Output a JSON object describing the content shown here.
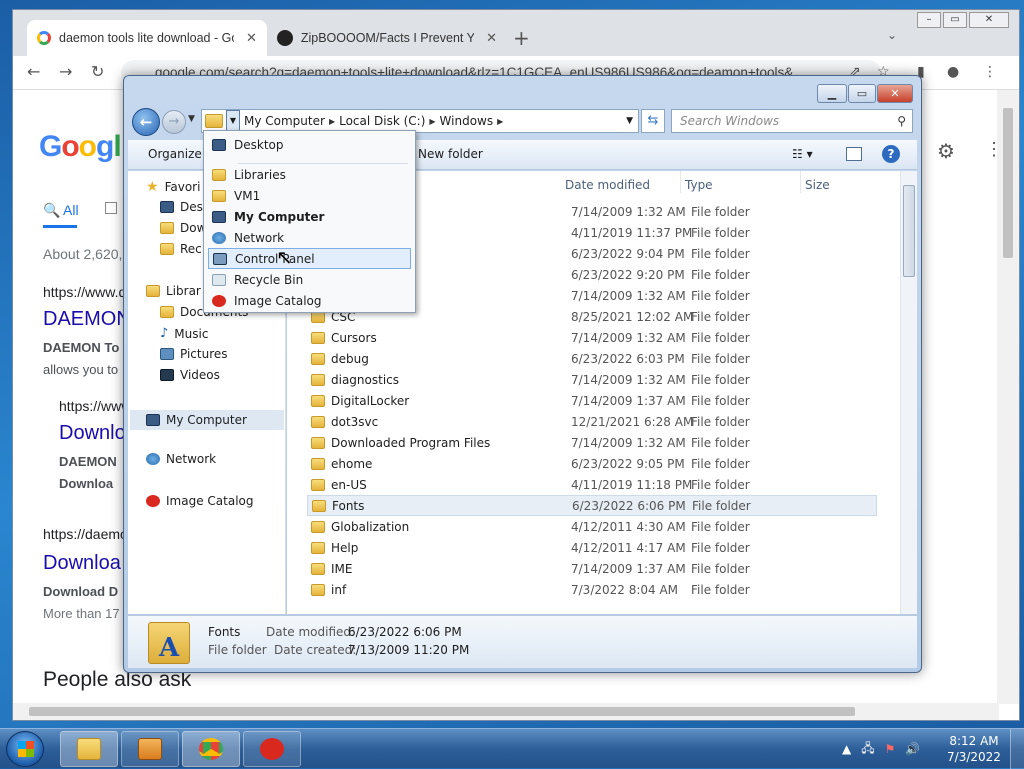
{
  "browser": {
    "tabs": [
      {
        "title": "daemon tools lite download - Go",
        "close": "✕"
      },
      {
        "title": "ZipBOOOOM/Facts I Prevent You",
        "close": "✕"
      }
    ],
    "new_tab": "+",
    "url": "google.com/search?q=daemon+tools+lite+download&rlz=1C1GCEA_enUS986US986&oq=deamon+tools&..."
  },
  "google": {
    "logo": [
      "G",
      "o",
      "o",
      "g",
      "l"
    ],
    "tab_all": "All",
    "results_count": "About 2,620,",
    "r1_url": "https://www.d",
    "r1_title": "DAEMON",
    "r1_snip1": "DAEMON To",
    "r1_snip2": "allows you to",
    "r1_sub_url": "https://www",
    "r1_sub_title": "Downlo",
    "r1_sub_snip1": "DAEMON",
    "r1_sub_snip2": "Downloa",
    "r2_url": "https://daemo",
    "r2_title": "Downloa",
    "r2_snip1": "Download D",
    "r2_snip2": "More than 17",
    "people_also_ask": "People also ask"
  },
  "explorer": {
    "breadcrumb": [
      "My Computer",
      "Local Disk (C:)",
      "Windows"
    ],
    "search_placeholder": "Search Windows",
    "cmd_organize": "Organize",
    "cmd_newfolder": "New folder",
    "nav": {
      "favorites": "Favori",
      "desktop": "Desl",
      "downloads": "Dow",
      "recent": "Rec",
      "libraries": "Librar",
      "documents": "Documents",
      "music": "Music",
      "pictures": "Pictures",
      "videos": "Videos",
      "my_computer": "My Computer",
      "network": "Network",
      "image_catalog": "Image Catalog"
    },
    "columns": {
      "date": "Date modified",
      "type": "Type",
      "size": "Size"
    },
    "files": [
      {
        "name": "",
        "date": "7/14/2009 1:32 AM",
        "type": "File folder"
      },
      {
        "name": "",
        "date": "4/11/2019 11:37 PM",
        "type": "File folder"
      },
      {
        "name": "",
        "date": "6/23/2022 9:04 PM",
        "type": "File folder"
      },
      {
        "name": "",
        "date": "6/23/2022 9:20 PM",
        "type": "File folder"
      },
      {
        "name": "Branding",
        "date": "7/14/2009 1:32 AM",
        "type": "File folder"
      },
      {
        "name": "CSC",
        "date": "8/25/2021 12:02 AM",
        "type": "File folder"
      },
      {
        "name": "Cursors",
        "date": "7/14/2009 1:32 AM",
        "type": "File folder"
      },
      {
        "name": "debug",
        "date": "6/23/2022 6:03 PM",
        "type": "File folder"
      },
      {
        "name": "diagnostics",
        "date": "7/14/2009 1:32 AM",
        "type": "File folder"
      },
      {
        "name": "DigitalLocker",
        "date": "7/14/2009 1:37 AM",
        "type": "File folder"
      },
      {
        "name": "dot3svc",
        "date": "12/21/2021 6:28 AM",
        "type": "File folder"
      },
      {
        "name": "Downloaded Program Files",
        "date": "7/14/2009 1:32 AM",
        "type": "File folder"
      },
      {
        "name": "ehome",
        "date": "6/23/2022 9:05 PM",
        "type": "File folder"
      },
      {
        "name": "en-US",
        "date": "4/11/2019 11:18 PM",
        "type": "File folder"
      },
      {
        "name": "Fonts",
        "date": "6/23/2022 6:06 PM",
        "type": "File folder"
      },
      {
        "name": "Globalization",
        "date": "4/12/2011 4:30 AM",
        "type": "File folder"
      },
      {
        "name": "Help",
        "date": "4/12/2011 4:17 AM",
        "type": "File folder"
      },
      {
        "name": "IME",
        "date": "7/14/2009 1:37 AM",
        "type": "File folder"
      },
      {
        "name": "inf",
        "date": "7/3/2022 8:04 AM",
        "type": "File folder"
      }
    ],
    "details": {
      "name": "Fonts",
      "kind": "File folder",
      "modified_label": "Date modified:",
      "modified": "6/23/2022 6:06 PM",
      "created_label": "Date created:",
      "created": "7/13/2009 11:20 PM"
    }
  },
  "dropdown": {
    "items": [
      "Desktop",
      "Libraries",
      "VM1",
      "My Computer",
      "Network",
      "Control Panel",
      "Recycle Bin",
      "Image Catalog"
    ],
    "hovered": "Control Panel"
  },
  "taskbar": {
    "time": "8:12 AM",
    "date": "7/3/2022"
  },
  "colors": {
    "accent": "#1a0dab",
    "selection": "#e2eefb",
    "taskbar": "#2e5f99"
  }
}
